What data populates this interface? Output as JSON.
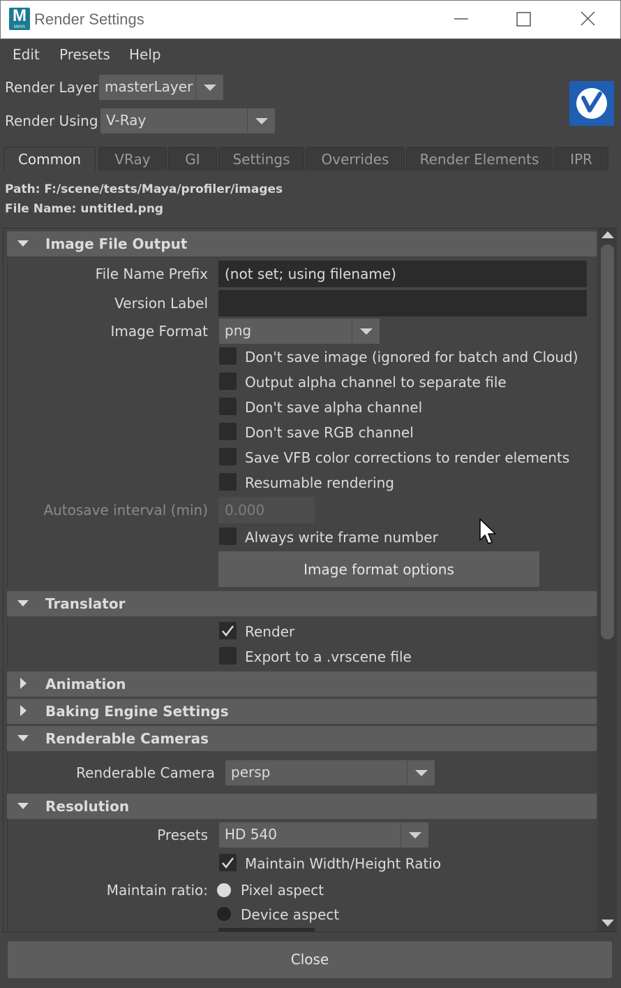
{
  "window": {
    "title": "Render Settings",
    "app_icon_letter": "M",
    "app_icon_text": "MAYA"
  },
  "menu": [
    "Edit",
    "Presets",
    "Help"
  ],
  "render_layer": {
    "label": "Render Layer",
    "value": "masterLayer"
  },
  "render_using": {
    "label": "Render Using",
    "value": "V-Ray"
  },
  "tabs": [
    "Common",
    "VRay",
    "GI",
    "Settings",
    "Overrides",
    "Render Elements",
    "IPR"
  ],
  "active_tab": "Common",
  "path_line": "Path: F:/scene/tests/Maya/profiler/images",
  "filename_line": "File Name: untitled.png",
  "sections": {
    "image_file_output": {
      "title": "Image File Output",
      "file_name_prefix_label": "File Name Prefix",
      "file_name_prefix_value": "(not set; using filename)",
      "version_label_label": "Version Label",
      "version_label_value": "",
      "image_format_label": "Image Format",
      "image_format_value": "png",
      "checkboxes": [
        {
          "label": "Don't save image (ignored for batch and Cloud)",
          "checked": false
        },
        {
          "label": "Output alpha channel to separate file",
          "checked": false
        },
        {
          "label": "Don't save alpha channel",
          "checked": false
        },
        {
          "label": "Don't save RGB channel",
          "checked": false
        },
        {
          "label": "Save VFB color corrections to render elements",
          "checked": false
        },
        {
          "label": "Resumable rendering",
          "checked": false
        }
      ],
      "autosave_label": "Autosave interval (min)",
      "autosave_value": "0.000",
      "always_write_frame_label": "Always write frame number",
      "image_format_options_button": "Image format options"
    },
    "translator": {
      "title": "Translator",
      "render_label": "Render",
      "render_checked": true,
      "export_label": "Export to a .vrscene file",
      "export_checked": false
    },
    "animation": {
      "title": "Animation"
    },
    "baking": {
      "title": "Baking Engine Settings"
    },
    "renderable_cameras": {
      "title": "Renderable Cameras",
      "camera_label": "Renderable Camera",
      "camera_value": "persp"
    },
    "resolution": {
      "title": "Resolution",
      "presets_label": "Presets",
      "presets_value": "HD 540",
      "maintain_wh_label": "Maintain Width/Height Ratio",
      "maintain_wh_checked": true,
      "maintain_ratio_label": "Maintain ratio:",
      "pixel_aspect_label": "Pixel aspect",
      "device_aspect_label": "Device aspect",
      "selected_ratio": "Device aspect"
    }
  },
  "close_button": "Close",
  "colors": {
    "background": "#444444",
    "input_dark": "#2b2b2b",
    "panel_gray": "#5d5d5d",
    "vray_blue": "#1f5eb3",
    "maya_teal": "#1b7a93"
  }
}
